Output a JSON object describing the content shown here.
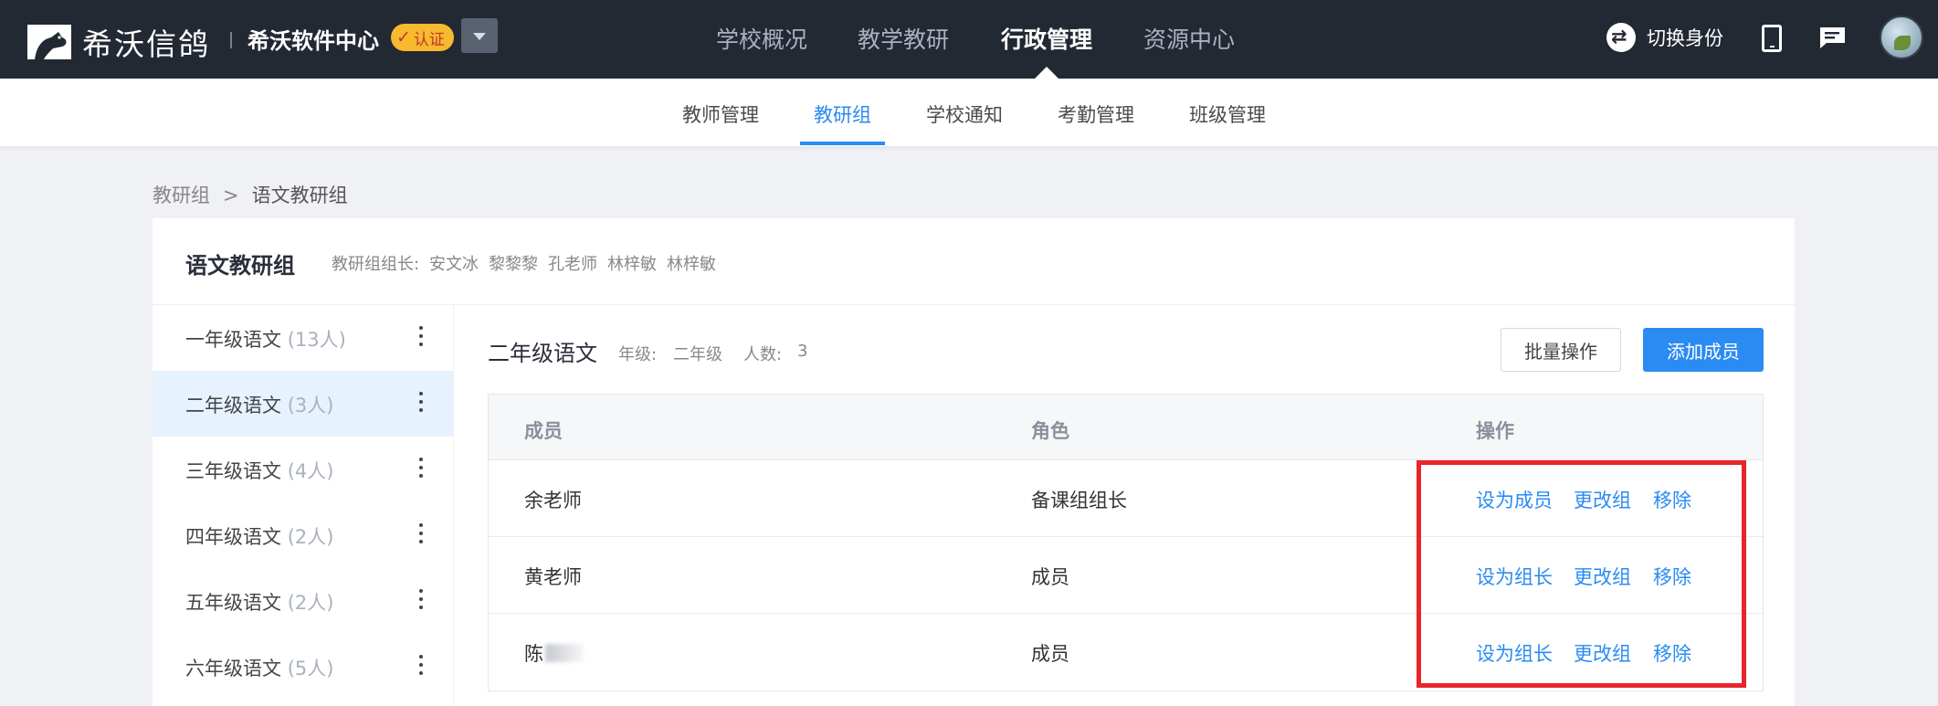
{
  "brand": {
    "logo_text": "希沃信鸽",
    "app_name": "希沃软件中心",
    "badge": "认证"
  },
  "main_nav": [
    {
      "label": "学校概况",
      "active": false
    },
    {
      "label": "教学教研",
      "active": false
    },
    {
      "label": "行政管理",
      "active": true
    },
    {
      "label": "资源中心",
      "active": false
    }
  ],
  "header_right": {
    "switch_label": "切换身份"
  },
  "sub_nav": [
    {
      "label": "教师管理",
      "active": false
    },
    {
      "label": "教研组",
      "active": true
    },
    {
      "label": "学校通知",
      "active": false
    },
    {
      "label": "考勤管理",
      "active": false
    },
    {
      "label": "班级管理",
      "active": false
    }
  ],
  "breadcrumb": {
    "parent": "教研组",
    "separator": ">",
    "current": "语文教研组"
  },
  "group": {
    "title": "语文教研组",
    "leader_label": "教研组组长:",
    "leaders": [
      "安文冰",
      "黎黎黎",
      "孔老师",
      "林梓敏",
      "林梓敏"
    ]
  },
  "subgroups": [
    {
      "name": "一年级语文",
      "count": "(13人)",
      "active": false
    },
    {
      "name": "二年级语文",
      "count": "(3人)",
      "active": true
    },
    {
      "name": "三年级语文",
      "count": "(4人)",
      "active": false
    },
    {
      "name": "四年级语文",
      "count": "(2人)",
      "active": false
    },
    {
      "name": "五年级语文",
      "count": "(2人)",
      "active": false
    },
    {
      "name": "六年级语文",
      "count": "(5人)",
      "active": false
    }
  ],
  "current": {
    "title": "二年级语文",
    "grade_label": "年级:",
    "grade": "二年级",
    "count_label": "人数:",
    "count": "3"
  },
  "buttons": {
    "batch": "批量操作",
    "add": "添加成员"
  },
  "table": {
    "headers": [
      "成员",
      "角色",
      "操作"
    ],
    "rows": [
      {
        "name": "余老师",
        "blurred": false,
        "role": "备课组组长",
        "actions": [
          "设为成员",
          "更改组",
          "移除"
        ]
      },
      {
        "name": "黄老师",
        "blurred": false,
        "role": "成员",
        "actions": [
          "设为组长",
          "更改组",
          "移除"
        ]
      },
      {
        "name": "陈",
        "blurred": true,
        "role": "成员",
        "actions": [
          "设为组长",
          "更改组",
          "移除"
        ]
      }
    ]
  },
  "colors": {
    "topbar": "#232933",
    "accent": "#2a8bf2",
    "highlight": "#e8262a",
    "badge": "#f7b92e"
  }
}
